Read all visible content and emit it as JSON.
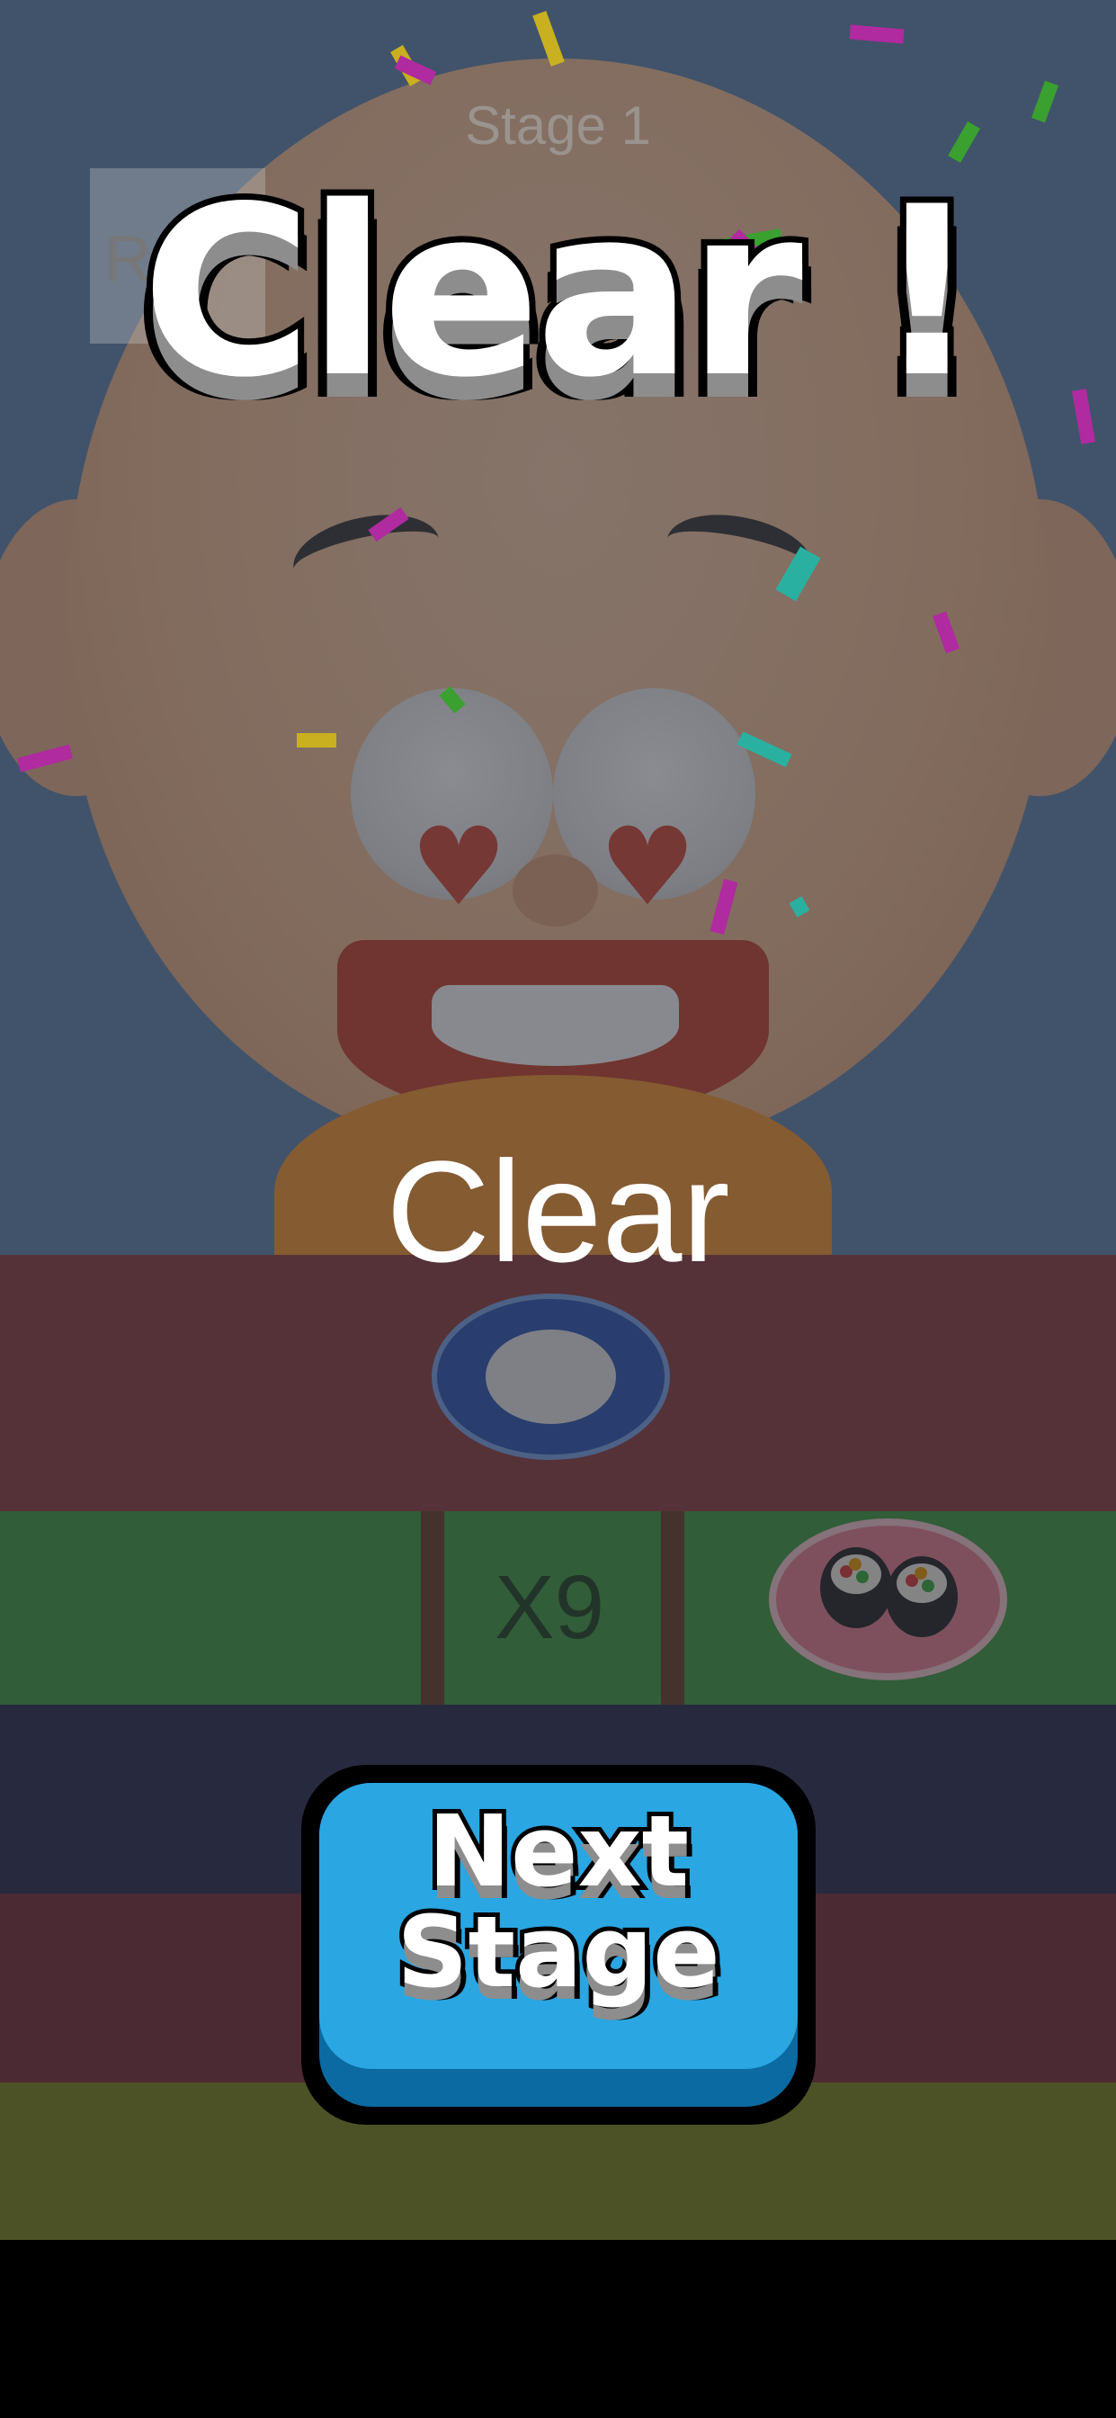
{
  "header": {
    "stage": "Stage 1",
    "pause_glyph": "R"
  },
  "result": {
    "title": "Clear !",
    "subtitle": "Clear"
  },
  "counter": {
    "plate_count": "X9"
  },
  "actions": {
    "next_label": "Next\nStage"
  },
  "icons": {
    "plate_empty": "blue-plate-icon",
    "sushi_plate": "sushi-plate-icon",
    "heart_eye": "heart-eye-icon"
  },
  "colors": {
    "button": "#2aa6e2",
    "button_shadow": "#0a6aa1",
    "counter_red": "#8c3a3a",
    "counter_green": "#3c9a3c"
  }
}
